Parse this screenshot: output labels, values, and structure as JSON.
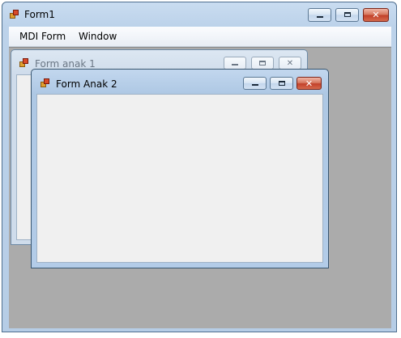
{
  "main_window": {
    "title": "Form1",
    "icon": "form-app-icon",
    "controls": {
      "minimize": "minimize-icon",
      "maximize": "maximize-icon",
      "close": "✕"
    }
  },
  "menubar": {
    "items": [
      {
        "label": "MDI Form"
      },
      {
        "label": "Window"
      }
    ]
  },
  "children": [
    {
      "title": "Form anak 1",
      "state": "inactive",
      "close_glyph": "✕"
    },
    {
      "title": "Form Anak 2",
      "state": "active",
      "close_glyph": "✕"
    }
  ],
  "colors": {
    "mdi_background": "#ababab",
    "form_background": "#f0f0f0",
    "close_button": "#c2412a"
  }
}
